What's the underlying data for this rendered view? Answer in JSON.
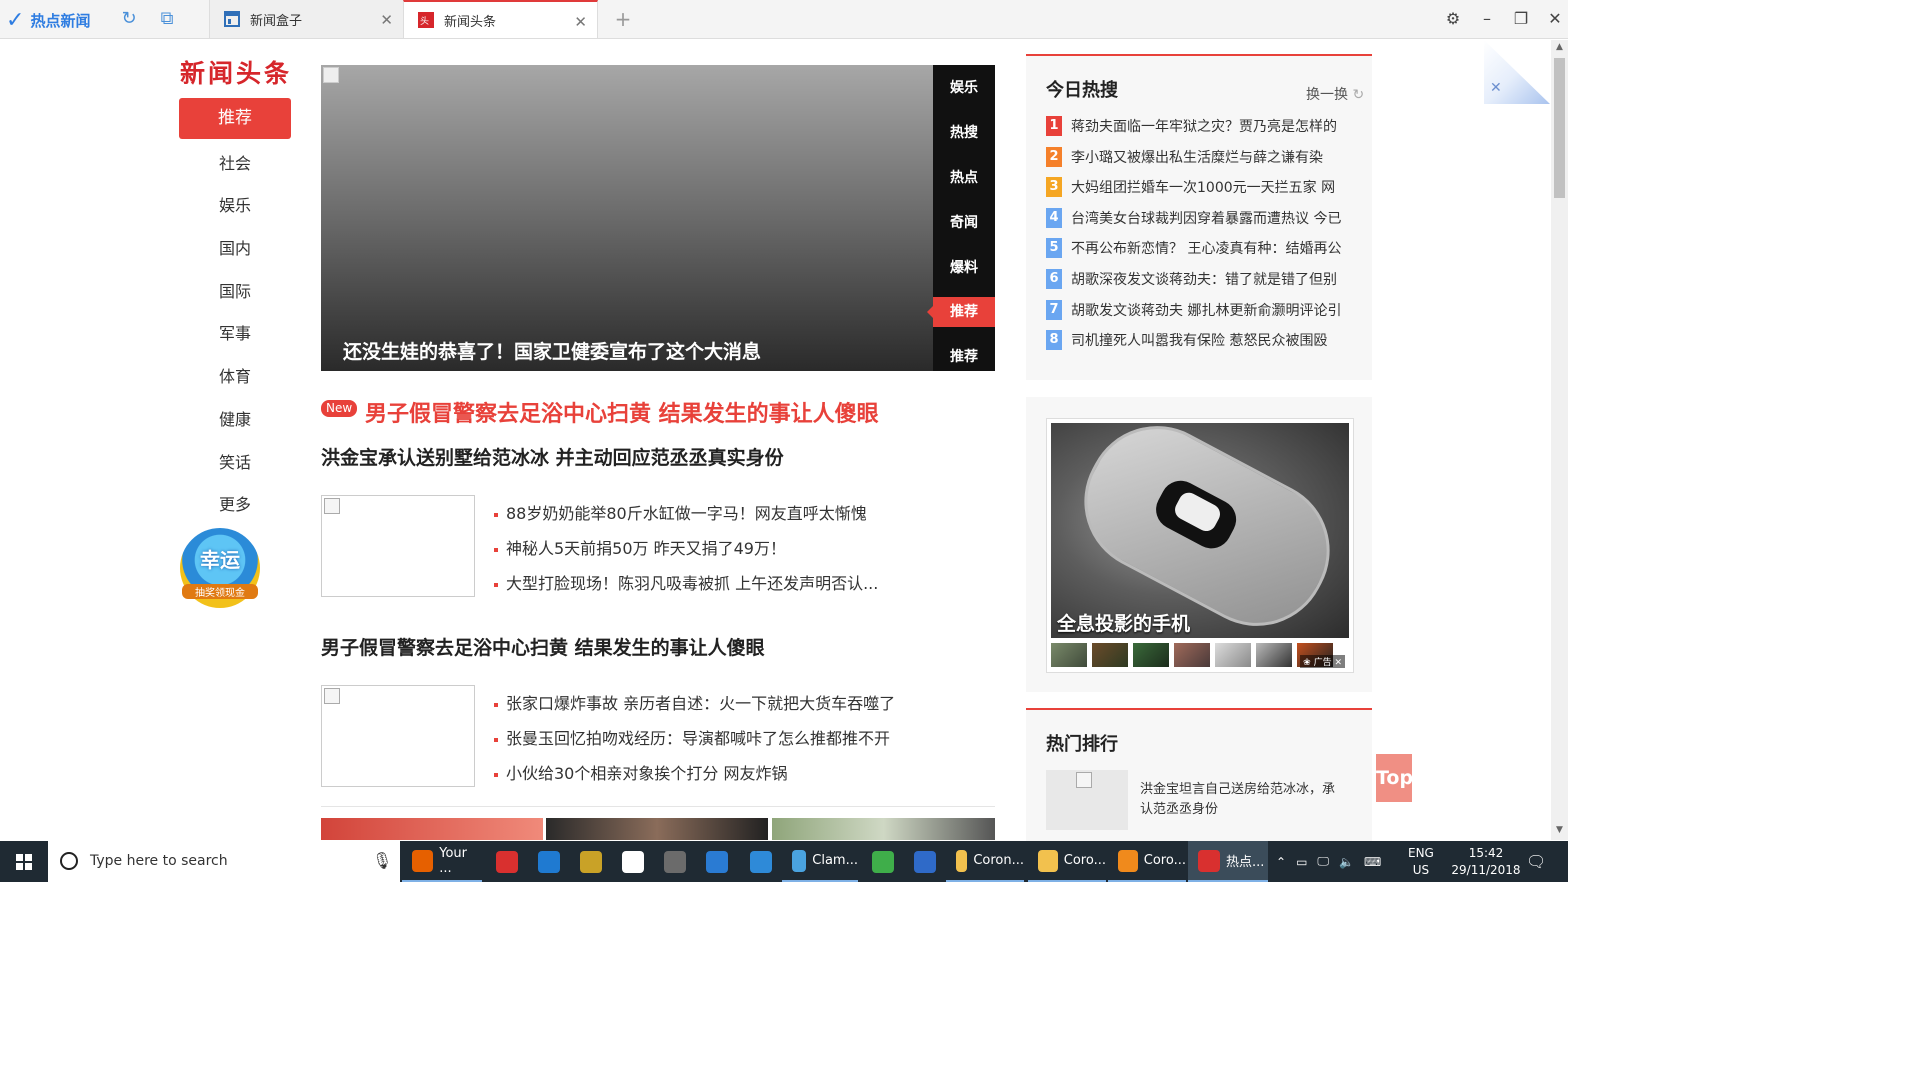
{
  "browser": {
    "app_name": "热点新闻",
    "tabs": [
      {
        "label": "新闻盒子",
        "active": false
      },
      {
        "label": "新闻头条",
        "active": true
      }
    ],
    "new_tab": "+"
  },
  "left_nav": {
    "brand": "新闻头条",
    "items": [
      "推荐",
      "社会",
      "娱乐",
      "国内",
      "国际",
      "军事",
      "体育",
      "健康",
      "笑话",
      "更多"
    ],
    "lucky_badge": {
      "title": "幸运",
      "sub": "抽奖领现金"
    }
  },
  "hero": {
    "caption": "还没生娃的恭喜了！国家卫健委宣布了这个大消息",
    "side_tabs": [
      "娱乐",
      "热搜",
      "热点",
      "奇闻",
      "爆料",
      "推荐",
      "推荐"
    ],
    "active_side": 5
  },
  "articles": {
    "new_badge": "New",
    "headline_red": "男子假冒警察去足浴中心扫黄 结果发生的事让人傻眼",
    "headline_2": "洪金宝承认送别墅给范冰冰 并主动回应范丞丞真实身份",
    "group1": [
      "88岁奶奶能举80斤水缸做一字马！网友直呼太惭愧",
      "神秘人5天前捐50万 昨天又捐了49万！",
      "大型打脸现场！陈羽凡吸毒被抓 上午还发声明否认..."
    ],
    "headline_3": "男子假冒警察去足浴中心扫黄 结果发生的事让人傻眼",
    "group2": [
      "张家口爆炸事故 亲历者自述：火一下就把大货车吞噬了",
      "张曼玉回忆拍吻戏经历：导演都喊咔了怎么推都推不开",
      "小伙给30个相亲对象挨个打分 网友炸锅"
    ]
  },
  "hot_search": {
    "title": "今日热搜",
    "refresh": "换一换",
    "items": [
      {
        "rank": "1",
        "text": "蒋劲夫面临一年牢狱之灾？贾乃亮是怎样的",
        "color": "#e8413a"
      },
      {
        "rank": "2",
        "text": "李小璐又被爆出私生活糜烂与薛之谦有染",
        "color": "#f5802a"
      },
      {
        "rank": "3",
        "text": "大妈组团拦婚车一次1000元一天拦五家 网",
        "color": "#f5a623"
      },
      {
        "rank": "4",
        "text": "台湾美女台球裁判因穿着暴露而遭热议 今已",
        "color": "#6aa6f1"
      },
      {
        "rank": "5",
        "text": "不再公布新恋情？ 王心凌真有种：结婚再公",
        "color": "#6aa6f1"
      },
      {
        "rank": "6",
        "text": "胡歌深夜发文谈蒋劲夫：错了就是错了但别",
        "color": "#6aa6f1"
      },
      {
        "rank": "7",
        "text": "胡歌发文谈蒋劲夫 娜扎林更新俞灏明评论引",
        "color": "#6aa6f1"
      },
      {
        "rank": "8",
        "text": "司机撞死人叫嚣我有保险 惹怒民众被围殴",
        "color": "#6aa6f1"
      }
    ]
  },
  "ad": {
    "caption": "全息投影的手机",
    "tag": "广告"
  },
  "hot_rank": {
    "title": "热门排行",
    "item_text": "洪金宝坦言自己送房给范冰冰，承认范丞丞身份"
  },
  "top_button": "Top",
  "taskbar": {
    "search_placeholder": "Type here to search",
    "apps": [
      {
        "label": "Your ...",
        "icon": "firefox-icon",
        "color": "#e66000"
      },
      {
        "label": "",
        "icon": "ccleaner-icon",
        "color": "#d9302f"
      },
      {
        "label": "",
        "icon": "outlook-icon",
        "color": "#1f7ad1"
      },
      {
        "label": "",
        "icon": "paint-icon",
        "color": "#c9a227"
      },
      {
        "label": "",
        "icon": "sticky-notes-icon",
        "color": "#ffffff"
      },
      {
        "label": "",
        "icon": "calculator-icon",
        "color": "#6b6b6b"
      },
      {
        "label": "",
        "icon": "defender-icon",
        "color": "#2a7bd3"
      },
      {
        "label": "",
        "icon": "computer-icon",
        "color": "#2e8ad8"
      },
      {
        "label": "Clam...",
        "icon": "clamwin-icon",
        "color": "#4aa3e0"
      },
      {
        "label": "",
        "icon": "shield-icon",
        "color": "#3fae4a"
      },
      {
        "label": "",
        "icon": "settings-icon",
        "color": "#2f6ac8"
      },
      {
        "label": "Coron...",
        "icon": "folder-icon",
        "color": "#f2c14e"
      },
      {
        "label": "Coro...",
        "icon": "folder-icon",
        "color": "#f2c14e"
      },
      {
        "label": "Coro...",
        "icon": "vlc-icon",
        "color": "#f08a1c"
      },
      {
        "label": "热点...",
        "icon": "news-app-icon",
        "color": "#d9302f"
      }
    ],
    "lang_1": "ENG",
    "lang_2": "US",
    "time": "15:42",
    "date": "29/11/2018"
  }
}
